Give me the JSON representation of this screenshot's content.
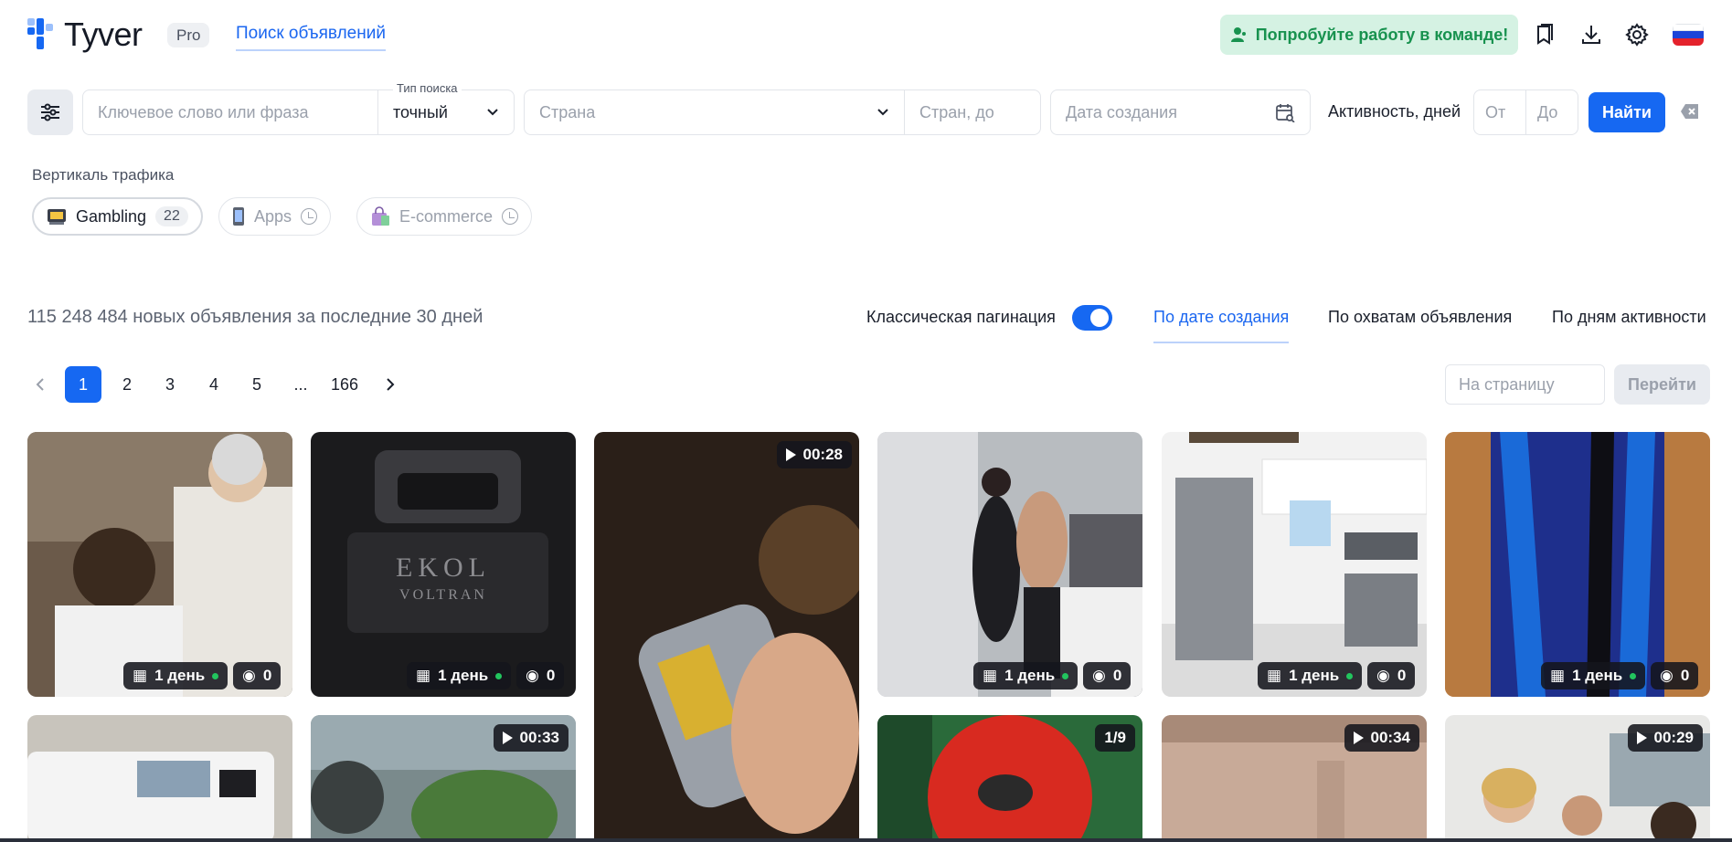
{
  "header": {
    "logo_text": "Tyver",
    "pro_badge": "Pro",
    "nav_link": "Поиск объявлений",
    "team_button": "Попробуйте работу в команде!",
    "icons": [
      "bookmarks-icon",
      "download-icon",
      "settings-icon",
      "flag-ru-icon"
    ],
    "colors": {
      "brand": "#1668f2",
      "team_green": "#18924f"
    }
  },
  "search": {
    "keyword_placeholder": "Ключевое слово или фраза",
    "search_type_label": "Тип поиска",
    "search_type_value": "точный",
    "country_placeholder": "Страна",
    "countries_to_placeholder": "Стран, до",
    "date_placeholder": "Дата создания",
    "activity_label": "Активность, дней",
    "from_placeholder": "От",
    "to_placeholder": "До",
    "find_button": "Найти"
  },
  "vertical": {
    "label": "Вертикаль трафика",
    "chips": [
      {
        "label": "Gambling",
        "count": "22",
        "active": true
      },
      {
        "label": "Apps",
        "active": false
      },
      {
        "label": "E-commerce",
        "active": false
      }
    ]
  },
  "results": {
    "count_text": "115 248 484 новых объявления за последние 30 дней",
    "pagination_toggle_label": "Классическая пагинация",
    "pagination_toggle_on": true,
    "sort_tabs": [
      "По дате создания",
      "По охватам объявления",
      "По дням активности"
    ],
    "active_sort": 0
  },
  "pagination": {
    "pages": [
      "1",
      "2",
      "3",
      "4",
      "5",
      "...",
      "166"
    ],
    "current": "1",
    "goto_placeholder": "На страницу",
    "goto_button": "Перейти"
  },
  "cards": [
    {
      "scene": "barber",
      "days": "1 день",
      "views": "0"
    },
    {
      "scene": "black-case",
      "days": "1 день",
      "views": "0"
    },
    {
      "scene": "card-reader",
      "duration": "00:28"
    },
    {
      "scene": "bedroom-couple",
      "days": "1 день",
      "views": "0"
    },
    {
      "scene": "kitchen",
      "days": "1 день",
      "views": "0"
    },
    {
      "scene": "blue-dress",
      "days": "1 день",
      "views": "0"
    },
    {
      "scene": "white-truck"
    },
    {
      "scene": "plant",
      "duration": "00:33"
    },
    {
      "scene": "red-mask",
      "counter": "1/9"
    },
    {
      "scene": "room-wall",
      "duration": "00:34"
    },
    {
      "scene": "office-people",
      "duration": "00:29"
    }
  ],
  "card_texts": {
    "case_brand": "EKOL",
    "case_model": "VOLTRAN"
  }
}
